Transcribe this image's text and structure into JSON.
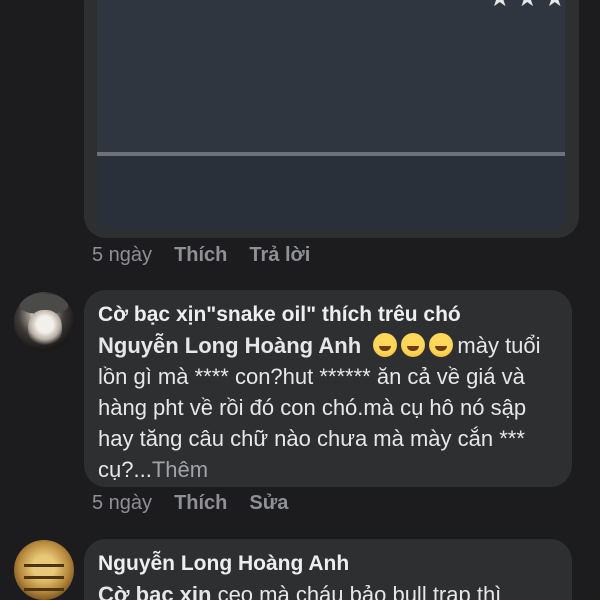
{
  "comment_top": {
    "image": {
      "stars": "★★★"
    },
    "actions": {
      "time": "5 ngày",
      "like": "Thích",
      "reply": "Trả lời"
    }
  },
  "comment_1": {
    "author": "Cờ bạc xịn\"snake oil\" thích trêu chó",
    "mention": "Nguyễn Long Hoàng Anh",
    "emoji": "rolling-on-floor-laughing-emoji",
    "text_after_emoji": "mày tuổi lồn gì mà **** con?hut ****** ăn cả về giá và hàng pht  về rồi đó con chó.mà cụ hô nó sập hay tăng câu chữ nào chưa mà mày cắn *** cụ?...",
    "more": "Thêm",
    "actions": {
      "time": "5 ngày",
      "like": "Thích",
      "edit": "Sửa"
    }
  },
  "comment_2": {
    "author": "Nguyễn Long Hoàng Anh",
    "mention": "Cờ bạc xịn",
    "text": "  ceo mà cháu bảo bull trap thì"
  }
}
